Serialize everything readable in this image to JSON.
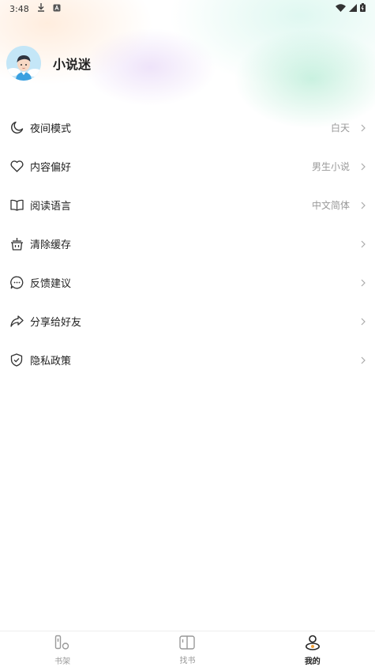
{
  "status_bar": {
    "time": "3:48",
    "icons": [
      "download-icon",
      "a-icon",
      "wifi-icon",
      "signal-icon",
      "battery-icon"
    ]
  },
  "profile": {
    "username": "小说迷"
  },
  "menu": [
    {
      "label": "夜间模式",
      "value": "白天",
      "icon": "moon-icon"
    },
    {
      "label": "内容偏好",
      "value": "男生小说",
      "icon": "heart-icon"
    },
    {
      "label": "阅读语言",
      "value": "中文简体",
      "icon": "book-icon"
    },
    {
      "label": "清除缓存",
      "value": "",
      "icon": "basket-icon"
    },
    {
      "label": "反馈建议",
      "value": "",
      "icon": "chat-bubble-icon"
    },
    {
      "label": "分享给好友",
      "value": "",
      "icon": "share-icon"
    },
    {
      "label": "隐私政策",
      "value": "",
      "icon": "shield-check-icon"
    }
  ],
  "bottom_nav": {
    "items": [
      {
        "label": "书架",
        "icon": "bookshelf-icon",
        "active": false
      },
      {
        "label": "找书",
        "icon": "find-book-icon",
        "active": false
      },
      {
        "label": "我的",
        "icon": "profile-icon",
        "active": true
      }
    ]
  },
  "colors": {
    "text_primary": "#222222",
    "text_secondary": "#999999",
    "divider": "#eeeeee"
  }
}
